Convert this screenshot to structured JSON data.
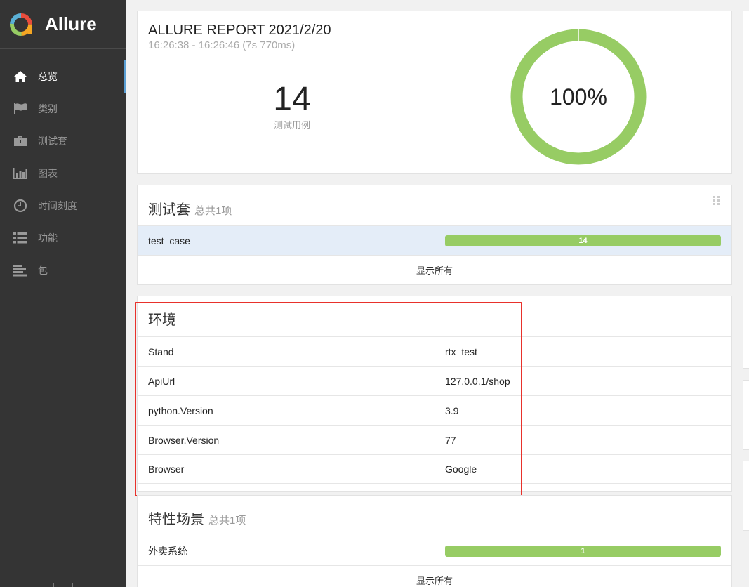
{
  "app": {
    "name": "Allure"
  },
  "sidebar": {
    "items": [
      {
        "label": "总览",
        "icon": "home-icon",
        "active": true
      },
      {
        "label": "类别",
        "icon": "flag-icon",
        "active": false
      },
      {
        "label": "测试套",
        "icon": "briefcase-icon",
        "active": false
      },
      {
        "label": "图表",
        "icon": "bar-chart-icon",
        "active": false
      },
      {
        "label": "时间刻度",
        "icon": "clock-icon",
        "active": false
      },
      {
        "label": "功能",
        "icon": "list-icon",
        "active": false
      },
      {
        "label": "包",
        "icon": "align-left-icon",
        "active": false
      }
    ]
  },
  "summary": {
    "title": "ALLURE REPORT 2021/2/20",
    "time": "16:26:38 - 16:26:46 (7s 770ms)",
    "total": "14",
    "total_label": "测试用例",
    "percent": "100%",
    "pass_fraction": 1.0,
    "pass_color": "#97cc64"
  },
  "suites": {
    "title": "测试套",
    "subtitle": "总共1项",
    "rows": [
      {
        "name": "test_case",
        "count": "14"
      }
    ],
    "show_all": "显示所有"
  },
  "environment": {
    "title": "环境",
    "rows": [
      {
        "key": "Stand",
        "value": "rtx_test"
      },
      {
        "key": "ApiUrl",
        "value": "127.0.0.1/shop"
      },
      {
        "key": "python.Version",
        "value": "3.9"
      },
      {
        "key": "Browser.Version",
        "value": "77"
      },
      {
        "key": "Browser",
        "value": "Google"
      }
    ]
  },
  "features": {
    "title": "特性场景",
    "subtitle": "总共1项",
    "rows": [
      {
        "name": "外卖系统",
        "count": "1"
      }
    ],
    "show_all": "显示所有"
  }
}
